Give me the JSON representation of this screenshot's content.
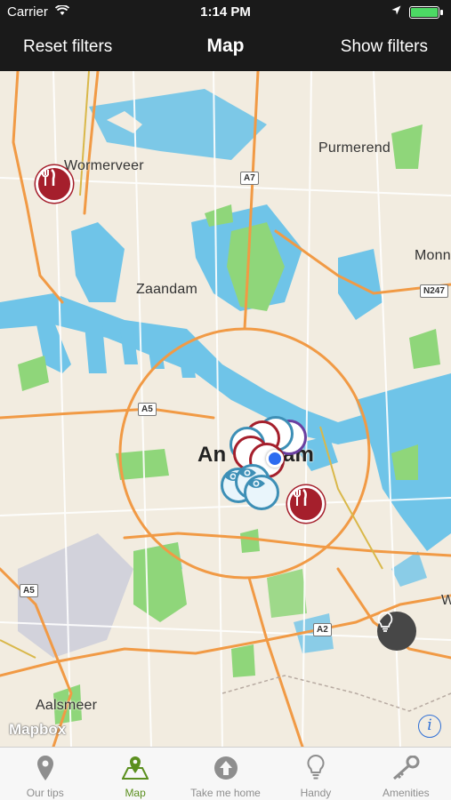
{
  "status_bar": {
    "carrier": "Carrier",
    "time": "1:14 PM",
    "battery_level": 1.0
  },
  "nav": {
    "left_button": "Reset filters",
    "title": "Map",
    "right_button": "Show filters"
  },
  "map": {
    "places": {
      "wormerveer": "Wormerveer",
      "purmerend": "Purmerend",
      "zaandam": "Zaandam",
      "monnickendam": "Monn",
      "amsterdam_left": "An",
      "amsterdam_right": "am",
      "aalsmeer": "Aalsmeer",
      "w_edge": "W"
    },
    "roads": {
      "a7": "A7",
      "a5_north": "A5",
      "a5_west": "A5",
      "a2": "A2",
      "n247": "N247"
    },
    "attribution": "Mapbox",
    "info_glyph": "i",
    "colors": {
      "land": "#f2ece0",
      "water": "#6fc4e8",
      "park": "#8fd67a",
      "highway": "#f19a45",
      "restaurant": "#a51f2c",
      "sight": "#3d8fb6",
      "user_location": "#2c6bf0"
    }
  },
  "tabs": [
    {
      "label": "Our tips",
      "icon": "pin-icon",
      "active": false
    },
    {
      "label": "Map",
      "icon": "map-pin-icon",
      "active": true
    },
    {
      "label": "Take me home",
      "icon": "arrow-up-circle-icon",
      "active": false
    },
    {
      "label": "Handy",
      "icon": "lightbulb-icon",
      "active": false
    },
    {
      "label": "Amenities",
      "icon": "key-icon",
      "active": false
    }
  ]
}
